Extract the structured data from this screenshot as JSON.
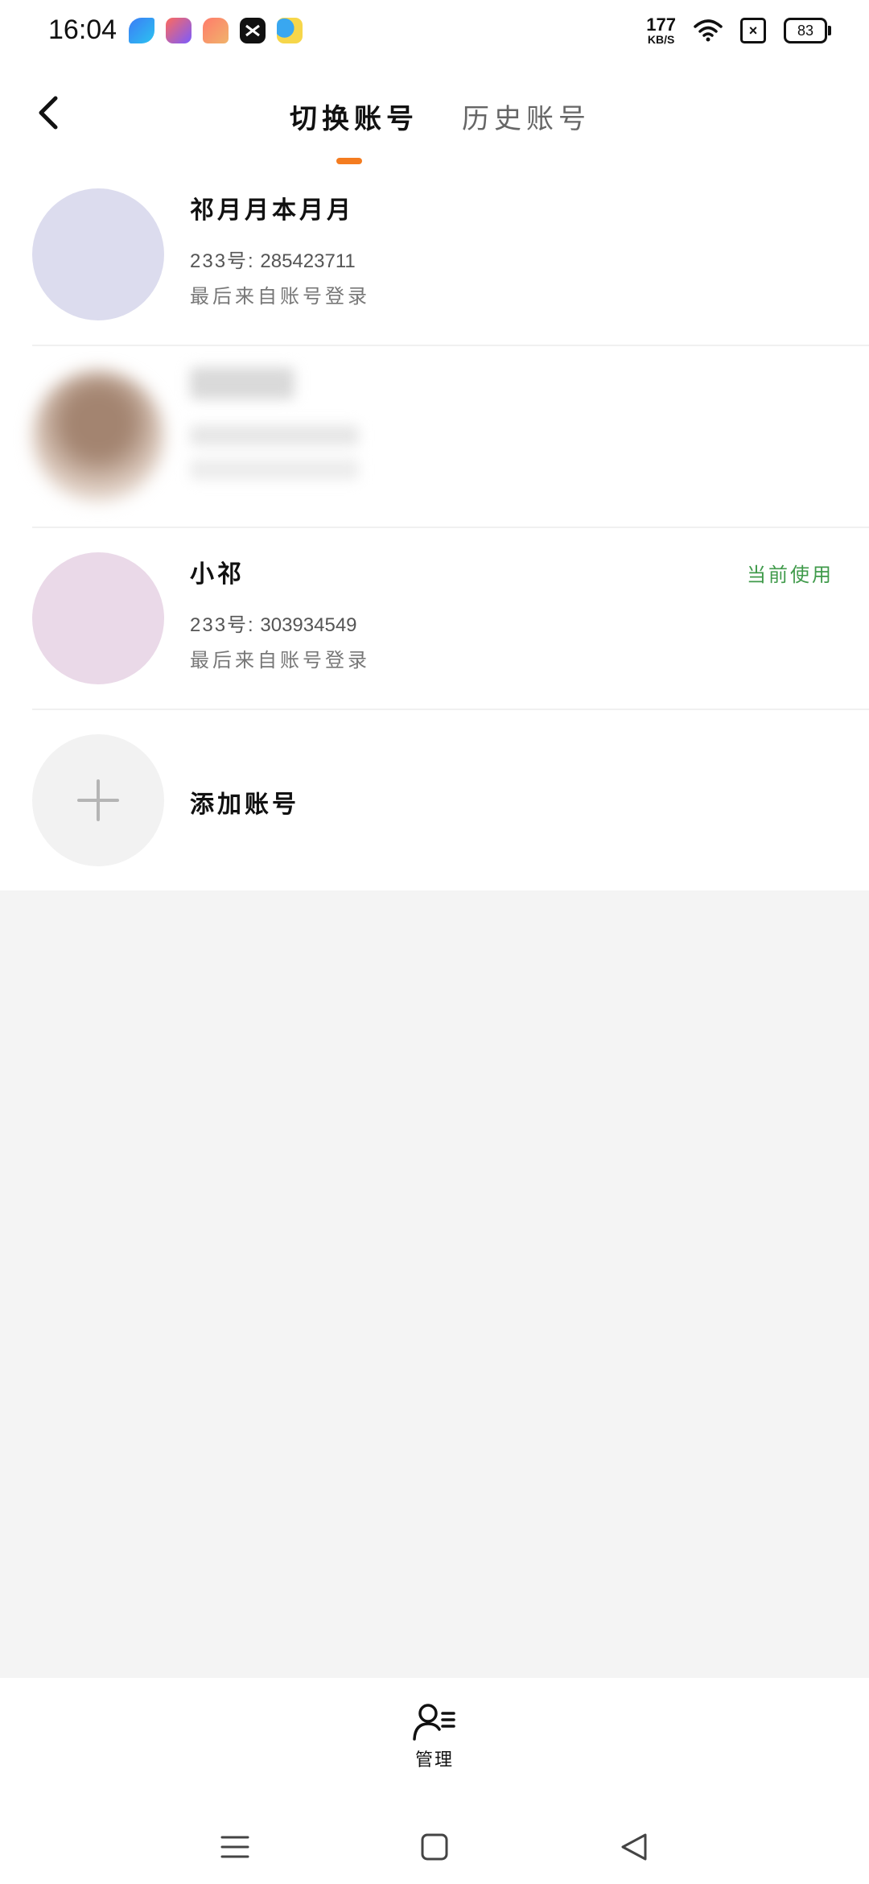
{
  "status_bar": {
    "time": "16:04",
    "net_speed_value": "177",
    "net_speed_unit": "KB/S",
    "battery": "83",
    "app_icons": [
      "feishu-icon",
      "shortcut-icon",
      "game-icon",
      "capcut-icon",
      "weather-icon"
    ]
  },
  "header": {
    "tabs": [
      {
        "label": "切换账号",
        "active": true
      },
      {
        "label": "历史账号",
        "active": false
      }
    ],
    "accent_color": "#f47c20"
  },
  "accounts": [
    {
      "name": "祁月月本月月",
      "id_label": "233号:",
      "id_value": "285423711",
      "source": "最后来自账号登录",
      "avatar_color": "#dcdcee",
      "current": false
    },
    {
      "blurred": true
    },
    {
      "name": "小祁",
      "id_label": "233号:",
      "id_value": "303934549",
      "source": "最后来自账号登录",
      "avatar_color": "#ead9e8",
      "current": true,
      "current_label": "当前使用",
      "current_color": "#3f9a4a"
    }
  ],
  "add_account": {
    "label": "添加账号"
  },
  "bottom": {
    "manage_label": "管理"
  }
}
